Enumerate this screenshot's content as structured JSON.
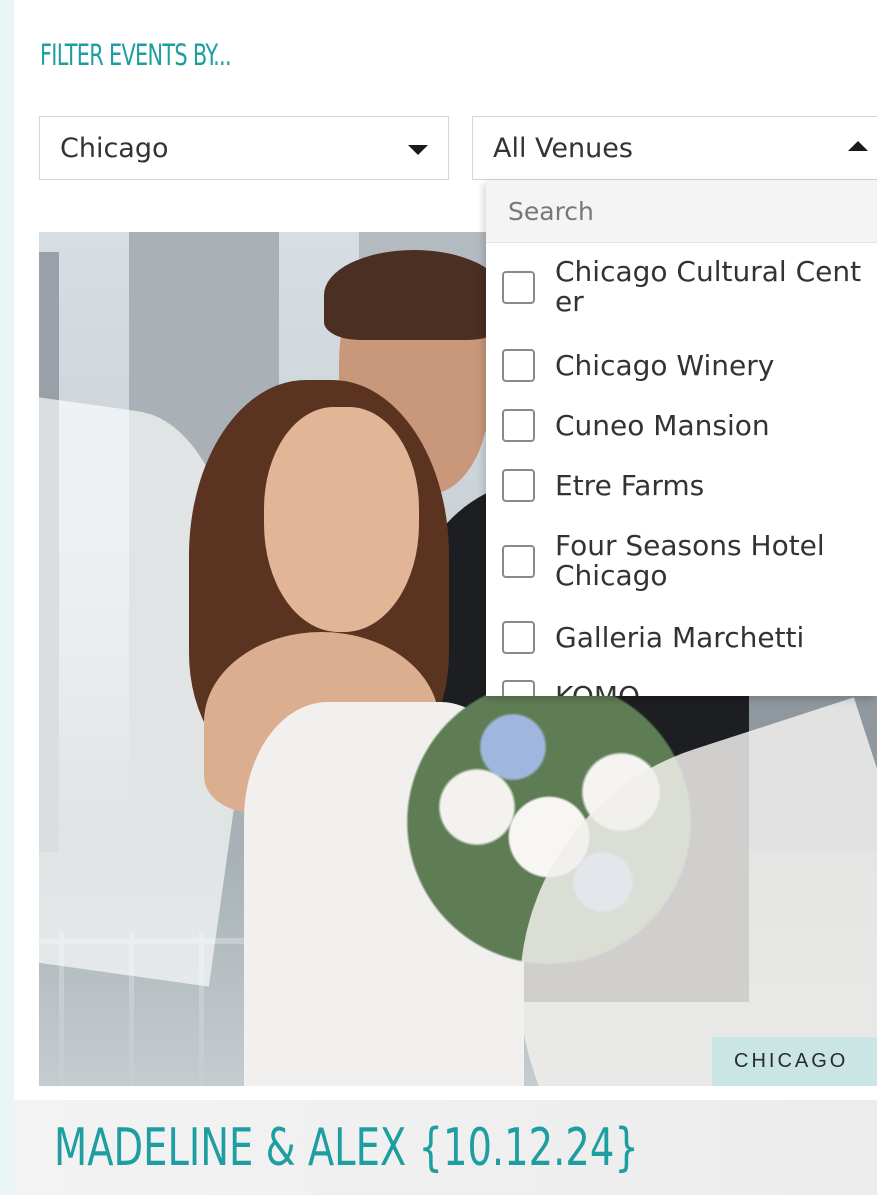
{
  "filter": {
    "heading": "FILTER EVENTS BY..."
  },
  "city_select": {
    "value": "Chicago"
  },
  "venue_select": {
    "value": "All Venues",
    "search_placeholder": "Search",
    "options": [
      "Chicago Cultural Center",
      "Chicago Winery",
      "Cuneo Mansion",
      "Etre Farms",
      "Four Seasons Hotel Chicago",
      "Galleria Marchetti",
      "KOMO"
    ]
  },
  "event": {
    "location_tag": "CHICAGO",
    "title": "MADELINE & ALEX {10.12.24}"
  },
  "colors": {
    "accent": "#1f9ea1",
    "tag_bg": "#c9e6e5"
  }
}
